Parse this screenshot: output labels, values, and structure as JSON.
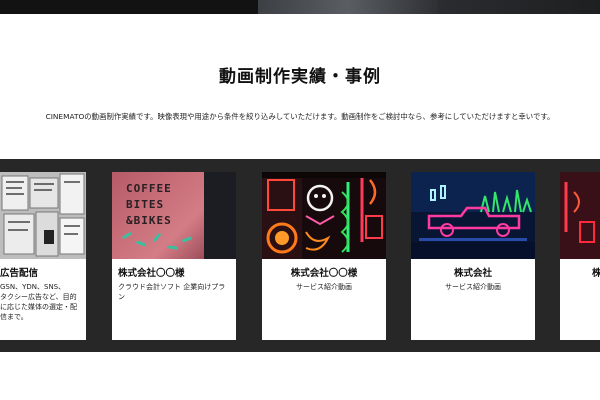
{
  "section": {
    "title": "動画制作実績・事例",
    "description": "CINEMATOの動画制作実績です。映像表現や用途から条件を絞り込みしていただけます。動画制作をご検討中なら、参考にしていただけますと幸いです。"
  },
  "cards": [
    {
      "title": "広告配信",
      "subtitle": "GSN、YDN、SNS、タクシー広告など、目的に応じた媒体の選定・配信まで。",
      "lines": [
        "GSN、YDN、SNS、",
        "タクシー広告など、目的",
        "に応じた媒体の選定・配",
        "信まで。"
      ],
      "thumb_icon": "newspaper-wall-image"
    },
    {
      "title": "株式会社〇〇様",
      "subtitle": "クラウド会計ソフト 企業向けプラン",
      "lines": [
        "クラウド会計ソフト 企業向けプラ",
        "ン"
      ],
      "thumb_text": [
        "COFFEE",
        "BITES",
        "&BIKES"
      ],
      "thumb_icon": "coffee-wall-image"
    },
    {
      "title": "株式会社〇〇様",
      "subtitle": "サービス紹介動画",
      "thumb_icon": "neon-signs-image"
    },
    {
      "title": "株式会社",
      "subtitle": "サービス紹介動画",
      "thumb_icon": "neon-truck-image"
    },
    {
      "title": "株",
      "thumb_icon": "neon-partial-image"
    }
  ],
  "colors": {
    "carousel_bg": "#272727",
    "card_bg": "#ffffff",
    "text": "#111111"
  }
}
